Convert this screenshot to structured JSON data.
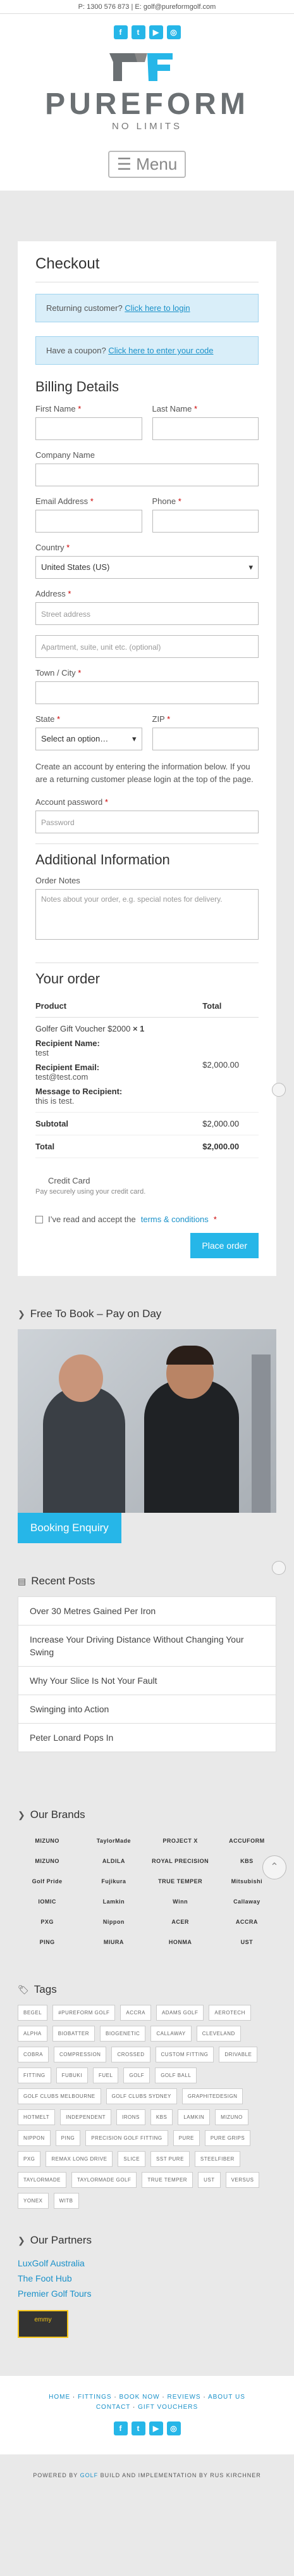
{
  "topbar": {
    "text": "P: 1300 576 873 | E: golf@pureformgolf.com"
  },
  "socials": [
    {
      "name": "facebook-icon",
      "glyph": "f"
    },
    {
      "name": "twitter-icon",
      "glyph": "t"
    },
    {
      "name": "youtube-icon",
      "glyph": "▶"
    },
    {
      "name": "instagram-icon",
      "glyph": "◎"
    }
  ],
  "logo": {
    "word": "PUREFORM",
    "tag": "NO LIMITS"
  },
  "menu": {
    "label": "☰ Menu"
  },
  "checkout": {
    "title": "Checkout",
    "returning_text": "Returning customer?",
    "returning_link": "Click here to login",
    "coupon_text": "Have a coupon?",
    "coupon_link": "Click here to enter your code",
    "billing_title": "Billing Details",
    "first_name": "First Name",
    "last_name": "Last Name",
    "company": "Company Name",
    "email": "Email Address",
    "phone": "Phone",
    "country_label": "Country",
    "country_value": "United States (US)",
    "address_label": "Address",
    "street_placeholder": "Street address",
    "apt_placeholder": "Apartment, suite, unit etc. (optional)",
    "town_label": "Town / City",
    "state_label": "State",
    "state_value": "Select an option…",
    "zip_label": "ZIP",
    "create_account": "Create an account by entering the information below. If you are a returning customer please login at the top of the page.",
    "password_label": "Account password",
    "password_placeholder": "Password",
    "additional_title": "Additional Information",
    "order_notes_label": "Order Notes",
    "order_notes_placeholder": "Notes about your order, e.g. special notes for delivery.",
    "order_title": "Your order",
    "col_product": "Product",
    "col_total": "Total",
    "item_name": "Golfer Gift Voucher $2000",
    "item_qty": "× 1",
    "item_total": "$2,000.00",
    "meta": [
      {
        "key": "Recipient Name:",
        "value": "test"
      },
      {
        "key": "Recipient Email:",
        "value": "test@test.com"
      },
      {
        "key": "Message to Recipient:",
        "value": "this is test."
      }
    ],
    "subtotal_label": "Subtotal",
    "subtotal_value": "$2,000.00",
    "total_label": "Total",
    "total_value": "$2,000.00",
    "payment_method": "Credit Card",
    "payment_desc": "Pay securely using your credit card.",
    "terms_text": "I’ve read and accept the",
    "terms_link": "terms & conditions",
    "place_order": "Place order"
  },
  "book_widget": {
    "title": "Free To Book – Pay on Day",
    "button": "Booking Enquiry"
  },
  "recent_posts": {
    "title": "Recent Posts",
    "items": [
      "Over 30 Metres Gained Per Iron",
      "Increase Your Driving Distance Without Changing Your Swing",
      "Why Your Slice Is Not Your Fault",
      "Swinging into Action",
      "Peter Lonard Pops In"
    ]
  },
  "brands": {
    "title": "Our Brands",
    "items": [
      "MIZUNO",
      "TaylorMade",
      "PROJECT X",
      "ACCUFORM",
      "MIZUNO",
      "ALDILA",
      "ROYAL PRECISION",
      "KBS",
      "Golf Pride",
      "Fujikura",
      "TRUE TEMPER",
      "Mitsubishi",
      "IOMIC",
      "Lamkin",
      "Winn",
      "Callaway",
      "PXG",
      "Nippon",
      "ACER",
      "ACCRA",
      "PING",
      "MIURA",
      "HONMA",
      "UST"
    ]
  },
  "tags": {
    "title": "Tags",
    "items": [
      "BEGEL",
      "#PUREFORM GOLF",
      "ACCRA",
      "ADAMS GOLF",
      "AEROTECH",
      "ALPHA",
      "BIOBATTER",
      "BIOGENETIC",
      "CALLAWAY",
      "CLEVELAND",
      "COBRA",
      "COMPRESSION",
      "CROSSED",
      "CUSTOM FITTING",
      "DRIVABLE",
      "FITTING",
      "FUBUKI",
      "FUEL",
      "GOLF",
      "GOLF BALL",
      "GOLF CLUBS MELBOURNE",
      "GOLF CLUBS SYDNEY",
      "GRAPHITEDESIGN",
      "HOTMELT",
      "INDEPENDENT",
      "IRONS",
      "KBS",
      "LAMKIN",
      "MIZUNO",
      "NIPPON",
      "PING",
      "PRECISION GOLF FITTING",
      "PURE",
      "PURE GRIPS",
      "PXG",
      "REMAX LONG DRIVE",
      "SLICE",
      "SST PURE",
      "STEELFIBER",
      "TAYLORMADE",
      "TAYLORMADE GOLF",
      "TRUE TEMPER",
      "UST",
      "VERSUS",
      "YONEX",
      "WITB"
    ]
  },
  "partners": {
    "title": "Our Partners",
    "items": [
      "LuxGolf Australia",
      "The Foot Hub",
      "Premier Golf Tours"
    ],
    "emblem": "emmy"
  },
  "footer": {
    "nav": [
      "HOME",
      "FITTINGS",
      "BOOK NOW",
      "REVIEWS",
      "ABOUT US",
      "CONTACT",
      "GIFT VOUCHERS"
    ],
    "copyright_prefix": "POWERED BY",
    "copyright_link": "GOLF",
    "copyright_suffix": "BUILD AND IMPLEMENTATION BY RUS KIRCHNER"
  },
  "colors": {
    "accent": "#26b6e8",
    "link": "#1a91c9"
  }
}
